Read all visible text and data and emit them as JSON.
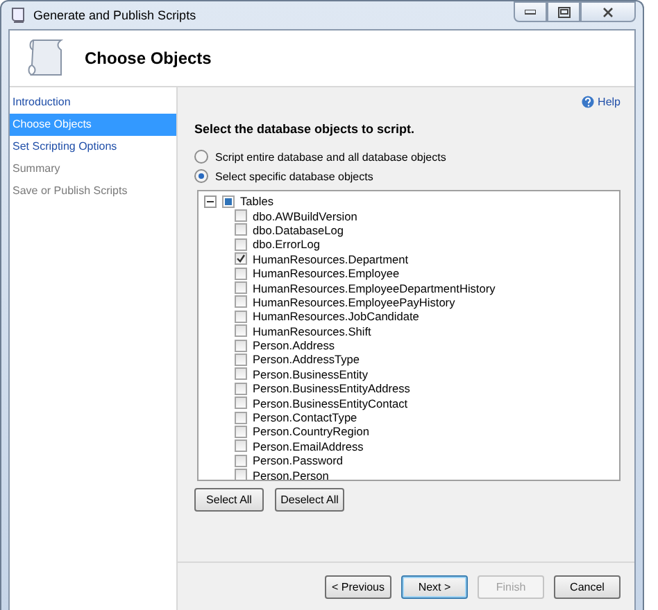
{
  "window": {
    "title": "Generate and Publish Scripts"
  },
  "header": {
    "title": "Choose Objects"
  },
  "sidebar": {
    "items": [
      {
        "label": "Introduction",
        "selected": false,
        "disabled": false
      },
      {
        "label": "Choose Objects",
        "selected": true,
        "disabled": false
      },
      {
        "label": "Set Scripting Options",
        "selected": false,
        "disabled": false
      },
      {
        "label": "Summary",
        "selected": false,
        "disabled": true
      },
      {
        "label": "Save or Publish Scripts",
        "selected": false,
        "disabled": true
      }
    ]
  },
  "help": {
    "label": "Help"
  },
  "prompt": "Select the database objects to script.",
  "options": [
    {
      "label": "Script entire database and all database objects",
      "selected": false
    },
    {
      "label": "Select specific database objects",
      "selected": true
    }
  ],
  "tree": {
    "label": "Tables",
    "expanded": true,
    "partial": true,
    "children": [
      {
        "label": "dbo.AWBuildVersion",
        "checked": false
      },
      {
        "label": "dbo.DatabaseLog",
        "checked": false
      },
      {
        "label": "dbo.ErrorLog",
        "checked": false
      },
      {
        "label": "HumanResources.Department",
        "checked": true
      },
      {
        "label": "HumanResources.Employee",
        "checked": false
      },
      {
        "label": "HumanResources.EmployeeDepartmentHistory",
        "checked": false
      },
      {
        "label": "HumanResources.EmployeePayHistory",
        "checked": false
      },
      {
        "label": "HumanResources.JobCandidate",
        "checked": false
      },
      {
        "label": "HumanResources.Shift",
        "checked": false
      },
      {
        "label": "Person.Address",
        "checked": false
      },
      {
        "label": "Person.AddressType",
        "checked": false
      },
      {
        "label": "Person.BusinessEntity",
        "checked": false
      },
      {
        "label": "Person.BusinessEntityAddress",
        "checked": false
      },
      {
        "label": "Person.BusinessEntityContact",
        "checked": false
      },
      {
        "label": "Person.ContactType",
        "checked": false
      },
      {
        "label": "Person.CountryRegion",
        "checked": false
      },
      {
        "label": "Person.EmailAddress",
        "checked": false
      },
      {
        "label": "Person.Password",
        "checked": false
      },
      {
        "label": "Person.Person",
        "checked": false
      }
    ]
  },
  "tree_buttons": [
    "Select All",
    "Deselect All"
  ],
  "footer_buttons": [
    {
      "label": "< Previous",
      "default": false,
      "disabled": false
    },
    {
      "label": "Next >",
      "default": true,
      "disabled": false
    },
    {
      "label": "Finish",
      "default": false,
      "disabled": true
    },
    {
      "label": "Cancel",
      "default": false,
      "disabled": false
    }
  ]
}
